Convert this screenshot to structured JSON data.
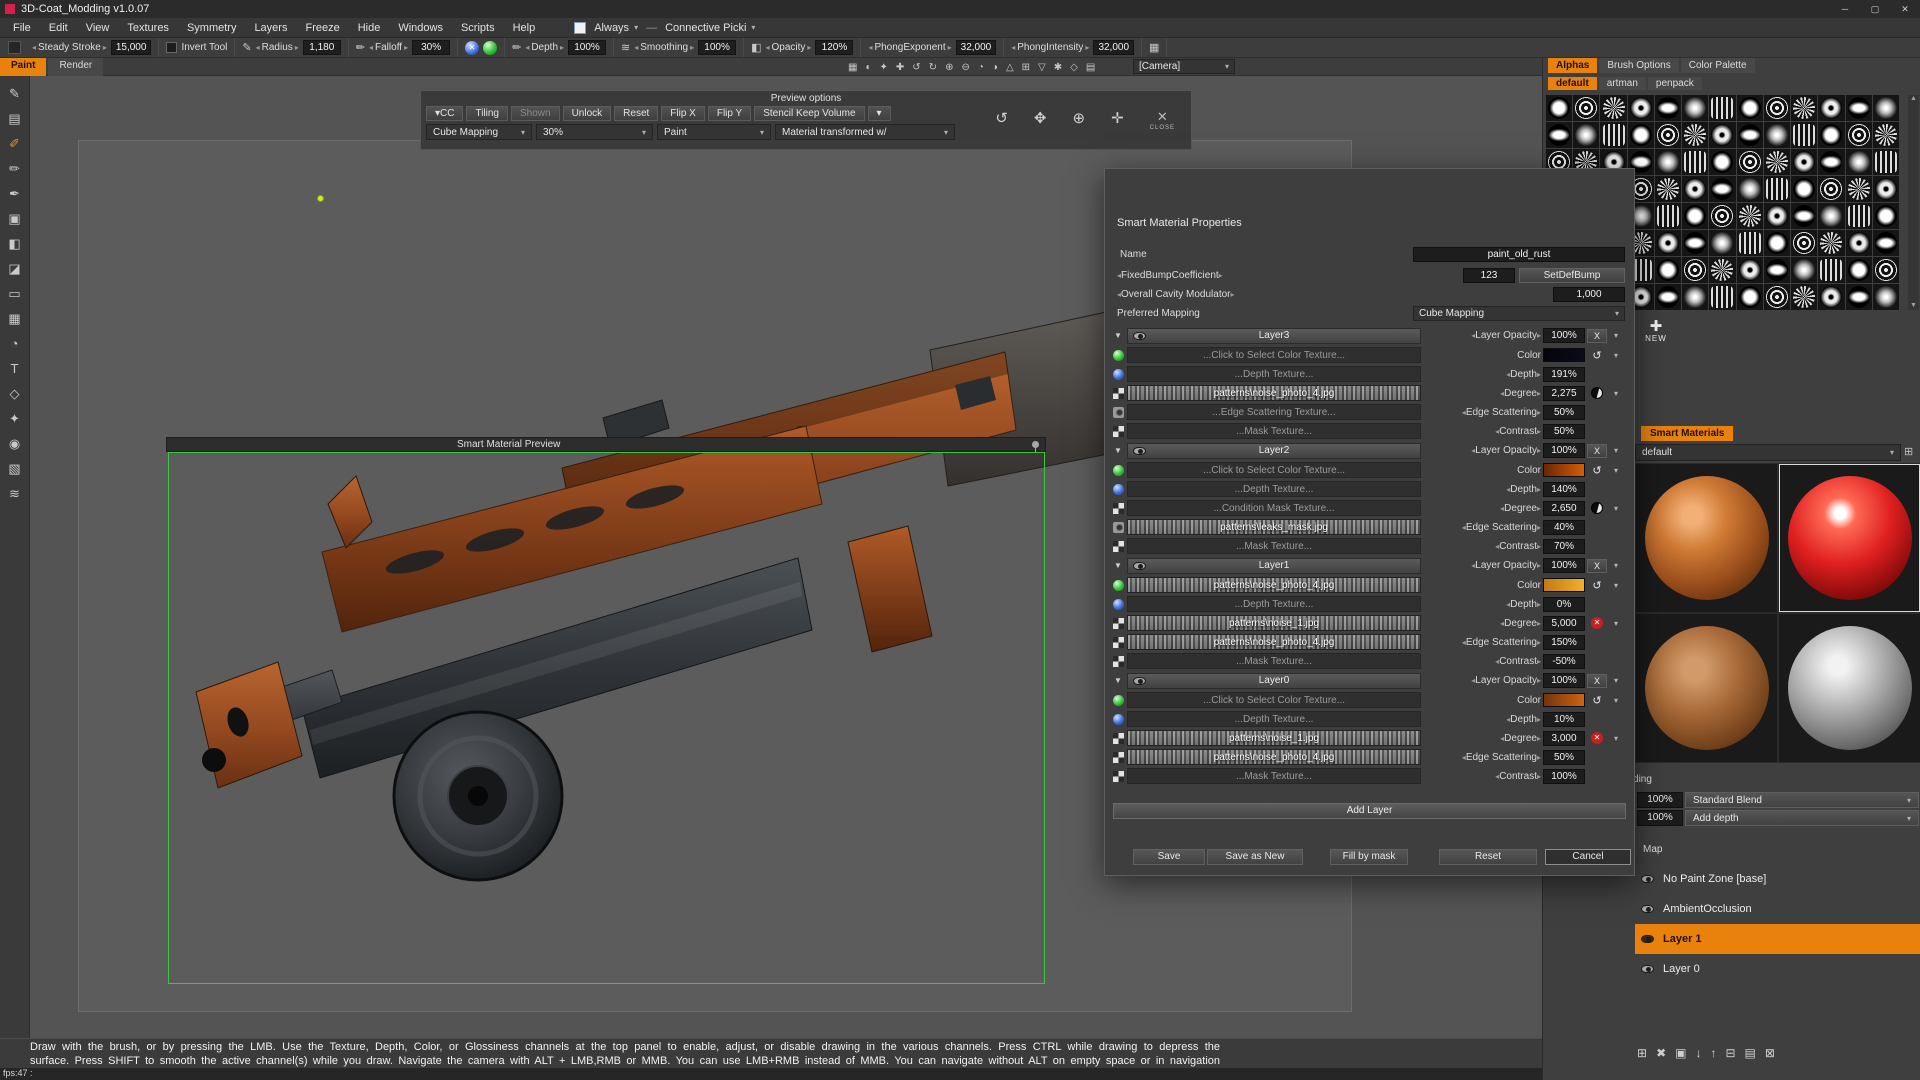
{
  "colors": {
    "accent": "#e8820c",
    "preview_frame_green": "#3ac83e",
    "selection_orange": "#e8820c"
  },
  "window": {
    "title": "3D-Coat_Modding v1.0.07",
    "minimize": "─",
    "maximize": "▢",
    "close": "✕"
  },
  "menu": {
    "items": [
      "File",
      "Edit",
      "View",
      "Textures",
      "Symmetry",
      "Layers",
      "Freeze",
      "Hide",
      "Windows",
      "Scripts",
      "Help"
    ],
    "always_label": "Always",
    "connective_label": "Connective Picki"
  },
  "toolbar": {
    "steady_stroke": {
      "label": "Steady Stroke",
      "value": "15,000"
    },
    "invert_tool_label": "Invert Tool",
    "radius": {
      "label": "Radius",
      "value": "1,180"
    },
    "falloff": {
      "label": "Falloff",
      "value": "30%"
    },
    "depth": {
      "label": "Depth",
      "value": "100%"
    },
    "smoothing": {
      "label": "Smoothing",
      "value": "100%"
    },
    "opacity": {
      "label": "Opacity",
      "value": "120%"
    },
    "phong_exponent": {
      "label": "PhongExponent",
      "value": "32,000"
    },
    "phong_intensity": {
      "label": "PhongIntensity",
      "value": "32,000"
    },
    "camera_label": "[Camera]"
  },
  "icon_strip": [
    {
      "name": "wireframe-icon",
      "glyph": "▦"
    },
    {
      "name": "shading-icon",
      "glyph": "◐"
    },
    {
      "name": "symmetry-icon",
      "glyph": "✦"
    },
    {
      "name": "snap-icon",
      "glyph": "✚"
    },
    {
      "name": "undo-icon",
      "glyph": "↺"
    },
    {
      "name": "redo-icon",
      "glyph": "↻"
    },
    {
      "name": "zoom-in-icon",
      "glyph": "⊕"
    },
    {
      "name": "zoom-out-icon",
      "glyph": "⊖"
    },
    {
      "name": "rotate-left-icon",
      "glyph": "◔"
    },
    {
      "name": "rotate-right-icon",
      "glyph": "◑"
    },
    {
      "name": "perspective-icon",
      "glyph": "△"
    },
    {
      "name": "grid-icon",
      "glyph": "⊞"
    },
    {
      "name": "ortho-icon",
      "glyph": "▽"
    },
    {
      "name": "light-icon",
      "glyph": "✱"
    },
    {
      "name": "ghost-icon",
      "glyph": "◇"
    },
    {
      "name": "params-icon",
      "glyph": "▤"
    }
  ],
  "left_toolbar": [
    {
      "name": "pencil-tool-icon",
      "glyph": "✎",
      "active": false
    },
    {
      "name": "stamp-tool-icon",
      "glyph": "▤",
      "active": false
    },
    {
      "name": "brush-tool-icon",
      "glyph": "✐",
      "active": true
    },
    {
      "name": "eraser-tool-icon",
      "glyph": "✏",
      "active": false
    },
    {
      "name": "pen-tool-icon",
      "glyph": "✒",
      "active": false
    },
    {
      "name": "clone-tool-icon",
      "glyph": "▣",
      "active": false
    },
    {
      "name": "fill-tool-icon",
      "glyph": "◧",
      "active": false
    },
    {
      "name": "gradient-tool-icon",
      "glyph": "◪",
      "active": false
    },
    {
      "name": "select-tool-icon",
      "glyph": "▭",
      "active": false
    },
    {
      "name": "pattern-tool-icon",
      "glyph": "▦",
      "active": false
    },
    {
      "name": "curve-tool-icon",
      "glyph": "◔",
      "active": false
    },
    {
      "name": "text-tool-icon",
      "glyph": "T",
      "active": false
    },
    {
      "name": "shape-tool-icon",
      "glyph": "◇",
      "active": false
    },
    {
      "name": "star-tool-icon",
      "glyph": "✦",
      "active": false
    },
    {
      "name": "eye-tool-icon",
      "glyph": "◉",
      "active": false
    },
    {
      "name": "hatch-tool-icon",
      "glyph": "▧",
      "active": false
    },
    {
      "name": "wave-tool-icon",
      "glyph": "≋",
      "active": false
    }
  ],
  "tabs": {
    "paint": "Paint",
    "render": "Render"
  },
  "preview_options": {
    "title": "Preview options",
    "row1": [
      {
        "label": "CC",
        "caret": true
      },
      {
        "label": "Tiling"
      },
      {
        "label": "Shown",
        "dim": true
      },
      {
        "label": "Unlock"
      },
      {
        "label": "Reset"
      },
      {
        "label": "Flip X"
      },
      {
        "label": "Flip Y"
      },
      {
        "label": "Stencil Keep Volume"
      }
    ],
    "row2": [
      "Cube Mapping",
      "30%",
      "Paint",
      "Material transformed w/"
    ],
    "close_label": "CLOSE"
  },
  "preview_window": {
    "title": "Smart Material Preview"
  },
  "dialog": {
    "title": "Smart Material Properties",
    "name_label": "Name",
    "name_value": "paint_old_rust",
    "fixed_bump_label": "FixedBumpCoefficient",
    "fixed_bump_value": "123",
    "set_def_bump_label": "SetDefBump",
    "cavity_label": "Overall Cavity Modulator",
    "cavity_value": "1,000",
    "mapping_label": "Preferred Mapping",
    "mapping_value": "Cube Mapping",
    "opacity_label": "Layer Opacity",
    "layers": [
      {
        "name": "Layer3",
        "opacity": "100%",
        "rows": [
          {
            "icon": "green-ball",
            "text": "...Click to Select Color Texture...",
            "file": false,
            "param": "Color",
            "swatch": [
              "#04040c",
              "#0b0b1a"
            ]
          },
          {
            "icon": "blue-ball",
            "text": "...Depth Texture...",
            "file": false,
            "param": "Depth",
            "value": "191%"
          },
          {
            "icon": "checker",
            "text": "patterns\\noise_photo_4.jpg",
            "file": true,
            "param": "Degree",
            "value": "2,275",
            "degree_icon": "moon"
          },
          {
            "icon": "camera",
            "text": "...Edge Scattering Texture...",
            "file": false,
            "param": "Edge Scattering",
            "value": "50%"
          },
          {
            "icon": "checker",
            "text": "...Mask Texture...",
            "file": false,
            "param": "Contrast",
            "value": "50%"
          }
        ]
      },
      {
        "name": "Layer2",
        "opacity": "100%",
        "rows": [
          {
            "icon": "green-ball",
            "text": "...Click to Select Color Texture...",
            "file": false,
            "param": "Color",
            "swatch": [
              "#6e2503",
              "#d35f08"
            ]
          },
          {
            "icon": "blue-ball",
            "text": "...Depth Texture...",
            "file": false,
            "param": "Depth",
            "value": "140%"
          },
          {
            "icon": "checker",
            "text": "...Condition Mask Texture...",
            "file": false,
            "param": "Degree",
            "value": "2,650",
            "degree_icon": "moon"
          },
          {
            "icon": "camera",
            "text": "patterns\\leaks_mask.jpg",
            "file": true,
            "param": "Edge Scattering",
            "value": "40%"
          },
          {
            "icon": "checker",
            "text": "...Mask Texture...",
            "file": false,
            "param": "Contrast",
            "value": "70%"
          }
        ]
      },
      {
        "name": "Layer1",
        "opacity": "100%",
        "rows": [
          {
            "icon": "green-ball",
            "text": "patterns\\noise_photo_4.jpg",
            "file": true,
            "param": "Color",
            "swatch": [
              "#c27a12",
              "#f2b02a"
            ]
          },
          {
            "icon": "blue-ball",
            "text": "...Depth Texture...",
            "file": false,
            "param": "Depth",
            "value": "0%"
          },
          {
            "icon": "checker",
            "text": "patterns\\noise_1.jpg",
            "file": true,
            "param": "Degree",
            "value": "5,000",
            "degree_icon": "red"
          },
          {
            "icon": "checker",
            "text": "patterns\\noise_photo_4.jpg",
            "file": true,
            "param": "Edge Scattering",
            "value": "150%"
          },
          {
            "icon": "checker",
            "text": "...Mask Texture...",
            "file": false,
            "param": "Contrast",
            "value": "-50%"
          }
        ]
      },
      {
        "name": "Layer0",
        "opacity": "100%",
        "rows": [
          {
            "icon": "green-ball",
            "text": "...Click to Select Color Texture...",
            "file": false,
            "param": "Color",
            "swatch": [
              "#73350a",
              "#cd6414"
            ]
          },
          {
            "icon": "blue-ball",
            "text": "...Depth Texture...",
            "file": false,
            "param": "Depth",
            "value": "10%"
          },
          {
            "icon": "checker",
            "text": "patterns\\noise_1.jpg",
            "file": true,
            "param": "Degree",
            "value": "3,000",
            "degree_icon": "red"
          },
          {
            "icon": "checker",
            "text": "patterns\\noise_photo_4.jpg",
            "file": true,
            "param": "Edge Scattering",
            "value": "50%"
          },
          {
            "icon": "checker",
            "text": "...Mask Texture...",
            "file": false,
            "param": "Contrast",
            "value": "100%"
          }
        ]
      }
    ],
    "add_layer_label": "Add Layer",
    "buttons": [
      {
        "label": "Save"
      },
      {
        "label": "Save as New"
      },
      {
        "label": "Fill by mask"
      },
      {
        "label": "Reset"
      },
      {
        "label": "Cancel",
        "accent": true
      }
    ]
  },
  "right_panel": {
    "tabs": [
      {
        "label": "Alphas",
        "active": true
      },
      {
        "label": "Brush Options",
        "active": false
      },
      {
        "label": "Color Palette",
        "active": false
      }
    ],
    "alpha_tabs": [
      {
        "label": "default",
        "active": true
      },
      {
        "label": "artman",
        "active": false
      },
      {
        "label": "penpack",
        "active": false
      }
    ],
    "alpha_grid": {
      "rows": 8,
      "cols": 13
    },
    "new_label": "NEW",
    "smart_materials_label": "Smart Materials",
    "materials_select": "default",
    "materials": [
      {
        "name": "orange-rust-material",
        "class": "m-orange",
        "selected": false
      },
      {
        "name": "red-glossy-material",
        "class": "m-red",
        "selected": true
      },
      {
        "name": "brown-rust-material",
        "class": "m-rust",
        "selected": false
      },
      {
        "name": "gray-metal-material",
        "class": "m-gray",
        "selected": false
      }
    ],
    "blending_label": "Blending",
    "blend_rows": [
      {
        "value": "100%",
        "mode": "Standard Blend"
      },
      {
        "value": "100%",
        "mode": "Add depth"
      }
    ],
    "map_label": "Map",
    "layer_list": [
      {
        "label": "No Paint Zone [base]",
        "selected": false
      },
      {
        "label": "AmbientOcclusion",
        "selected": false
      },
      {
        "label": "Layer 1",
        "selected": true
      },
      {
        "label": "Layer 0",
        "selected": false
      }
    ],
    "bottom_icons": [
      {
        "name": "add-layer-icon",
        "glyph": "⊞"
      },
      {
        "name": "delete-layer-icon",
        "glyph": "✖"
      },
      {
        "name": "duplicate-layer-icon",
        "glyph": "▣"
      },
      {
        "name": "merge-down-icon",
        "glyph": "↓"
      },
      {
        "name": "merge-up-icon",
        "glyph": "↑"
      },
      {
        "name": "move-layer-icon",
        "glyph": "⊟"
      },
      {
        "name": "layer-options-icon",
        "glyph": "▤"
      },
      {
        "name": "layer-fx-icon",
        "glyph": "⊠"
      }
    ]
  },
  "status": {
    "line1": "Draw with the brush, or by pressing the LMB. Use the Texture, Depth, Color, or Glossiness channels at the top panel to enable, adjust, or disable drawing in the various channels. Press CTRL while drawing to depress the",
    "line2": "surface. Press SHIFT to smooth the active channel(s) while you draw. Navigate the camera with ALT + LMB,RMB or MMB. You can use LMB+RMB instead of MMB. You can navigate without ALT on empty space or in navigation",
    "fps": "fps:47 :"
  }
}
